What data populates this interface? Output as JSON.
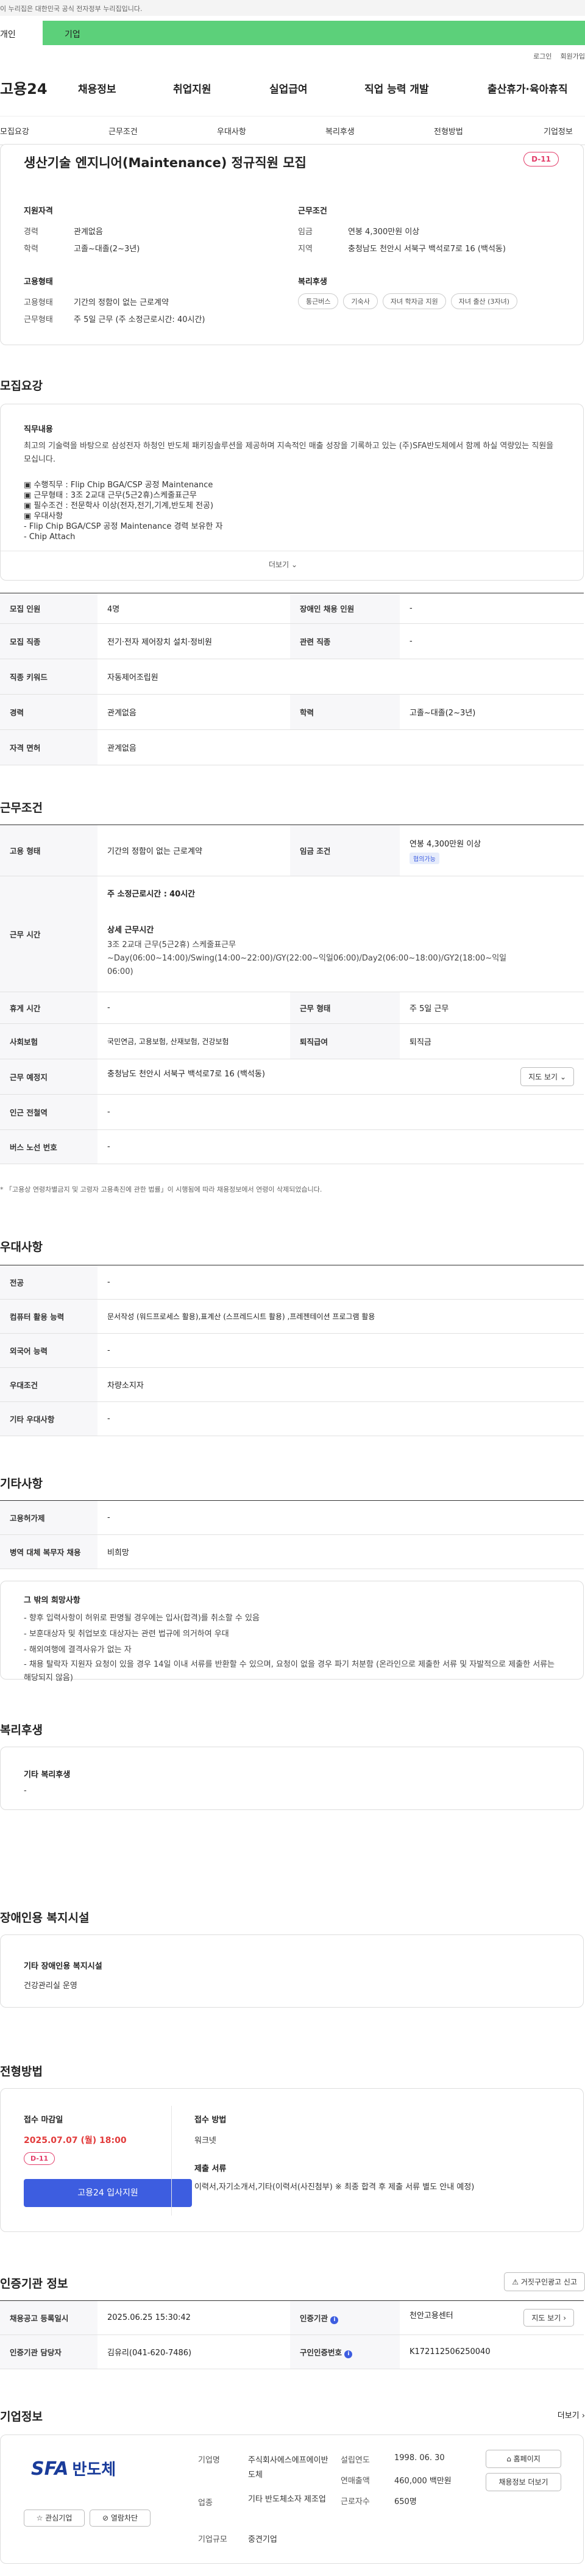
{
  "gov_banner": "이 누리집은 대한민국 공식 전자정부 누리집입니다.",
  "audience_tabs": [
    "개인",
    "기업"
  ],
  "util_links": [
    "로그인",
    "회원가입"
  ],
  "gnb": {
    "logo": "고용24",
    "menu": [
      "채용정보",
      "취업지원",
      "실업급여",
      "직업 능력 개발",
      "출산휴가·육아휴직"
    ]
  },
  "subnav": [
    "모집요강",
    "근무조건",
    "우대사항",
    "복리후생",
    "전형방법",
    "기업정보"
  ],
  "job": {
    "title": "생산기술 엔지니어(Maintenance) 정규직원 모집",
    "dday": "D-11",
    "qual_title": "지원자격",
    "qual": [
      {
        "k": "경력",
        "v": "관계없음"
      },
      {
        "k": "학력",
        "v": "고졸~대졸(2~3년)"
      }
    ],
    "cond_title": "근무조건",
    "cond": [
      {
        "k": "임금",
        "v": "연봉 4,300만원 이상"
      },
      {
        "k": "지역",
        "v": "충청남도 천안시 서북구 백석로7로 16 (백석동)"
      }
    ],
    "emp_title": "고용형태",
    "emp": [
      {
        "k": "고용형태",
        "v": "기간의 정함이 없는 근로계약"
      },
      {
        "k": "근무형태",
        "v": "주 5일 근무 (주 소정근로시간: 40시간)"
      }
    ],
    "welfare_title": "복리후생",
    "welfare_chips": [
      "통근버스",
      "기숙사",
      "자녀 학자금 지원",
      "자녀 출산 (3자녀)"
    ]
  },
  "recruit": {
    "title": "모집요강",
    "duty_title": "직무내용",
    "duty_intro": "최고의 기술력을 바탕으로 삼성전자 하청인 반도체 패키징솔루션을 제공하며 지속적인 매출 성장을 기록하고 있는 (주)SFA반도체에서 함께 하실 역량있는 직원을 모십니다.",
    "duty_lines": [
      "▣ 수행직무 : Flip Chip BGA/CSP 공정 Maintenance",
      "▣ 근무형태 : 3조 2교대 근무(5근2휴)스케줄표근무",
      "▣ 필수조건 : 전문학사 이상(전자,전기,기계,반도체 전공)",
      "▣ 우대사항",
      "- Flip Chip BGA/CSP 공정 Maintenance 경력 보유한 자",
      "- Chip Attach"
    ],
    "more": "더보기",
    "rows": [
      [
        {
          "th": "모집 인원",
          "td": "4명"
        },
        {
          "th": "장애인 채용 인원",
          "td": "-"
        }
      ],
      [
        {
          "th": "모집 직종",
          "td": "전기·전자 제어장치 설치·정비원"
        },
        {
          "th": "관련 직종",
          "td": "-"
        }
      ],
      [
        {
          "th": "직종 키워드",
          "td": "자동제어조립원"
        }
      ],
      [
        {
          "th": "경력",
          "td": "관계없음"
        },
        {
          "th": "학력",
          "td": "고졸~대졸(2~3년)"
        }
      ],
      [
        {
          "th": "자격 면허",
          "td": "관계없음"
        }
      ]
    ]
  },
  "work": {
    "title": "근무조건",
    "emp_th": "고용 형태",
    "emp_td": "기간의 정함이 없는 근로계약",
    "wage_th": "임금 조건",
    "wage_td": "연봉 4,300만원 이상",
    "wage_badge": "협의가능",
    "hours_th": "근무 시간",
    "hours_week": "주 소정근로시간 :",
    "hours_week_v": "40시간",
    "hours_detail_title": "상세 근무시간",
    "hours_detail": "3조 2교대 근무(5근2휴) 스케줄표근무\n~Day(06:00~14:00)/Swing(14:00~22:00)/GY(22:00~익일06:00)/Day2(06:00~18:00)/GY2(18:00~익일06:00)",
    "rows": [
      [
        {
          "th": "휴게 시간",
          "td": "-"
        },
        {
          "th": "근무 형태",
          "td": "주 5일 근무"
        }
      ],
      [
        {
          "th": "사회보험",
          "td": "국민연금, 고용보험, 산재보험, 건강보험"
        },
        {
          "th": "퇴직급여",
          "td": "퇴직금"
        }
      ]
    ],
    "place_th": "근무 예정지",
    "place_td": "충청남도 천안시 서북구 백석로7로 16 (백석동)",
    "map_btn": "지도 보기",
    "rows2": [
      {
        "th": "인근 전철역",
        "td": "-"
      },
      {
        "th": "버스 노선 번호",
        "td": "-"
      }
    ],
    "note": "* 「고용상 연령차별금지 및 고령자 고용촉진에 관한 법률」이 시행됨에 따라 채용정보에서 연령이 삭제되었습니다."
  },
  "pref": {
    "title": "우대사항",
    "rows": [
      {
        "th": "전공",
        "td": "-"
      },
      {
        "th": "컴퓨터 활용 능력",
        "td": "문서작성 (워드프로세스 활용),표계산 (스프레드시트 활용) ,프레젠테이션 프로그램 활용"
      },
      {
        "th": "외국어 능력",
        "td": "-"
      },
      {
        "th": "우대조건",
        "td": "차량소지자"
      },
      {
        "th": "기타 우대사항",
        "td": "-"
      }
    ]
  },
  "etc": {
    "title": "기타사항",
    "rows": [
      {
        "th": "고용허가제",
        "td": "-"
      },
      {
        "th": "병역 대체 복무자 채용",
        "td": "비희망"
      }
    ],
    "extra_title": "그 밖의 희망사항",
    "extra": [
      "- 향후 입력사항이 허위로 판명될 경우에는 입사(합격)를 취소할 수 있음",
      "- 보훈대상자 및 취업보호 대상자는 관련 법규에 의거하여 우대",
      "- 해외여행에 결격사유가 없는 자",
      "- 채용 탈락자 지원자 요청이 있을 경우 14일 이내 서류를 반환할 수 있으며, 요청이 없을 경우 파기 처분함 (온라인으로 제출한 서류 및 자발적으로 제출한 서류는 해당되지 않음)"
    ]
  },
  "welfare": {
    "title": "복리후생",
    "box_title": "기타 복리후생",
    "box_value": "-"
  },
  "disab": {
    "title": "장애인용 복지시설",
    "box_title": "기타 장애인용 복지시설",
    "box_value": "건강관리실 운영"
  },
  "process": {
    "title": "전형방법",
    "deadline_label": "접수 마감일",
    "deadline": "2025.07.07 (월) 18:00",
    "dday": "D-11",
    "apply_btn": "고용24 입사지원",
    "method_label": "접수 방법",
    "method": "워크넷",
    "docs_label": "제출 서류",
    "docs": "이력서,자기소개서,기타(이력서(사진첨부) ※ 최종 합격 후 제출 서류 별도 안내 예정)"
  },
  "certify": {
    "title": "인증기관 정보",
    "report_btn": "거짓구인광고 신고",
    "rows": [
      [
        {
          "th": "채용공고 등록일시",
          "td": "2025.06.25 15:30:42"
        },
        {
          "th": "인증기관",
          "td": "천안고용센터"
        }
      ],
      [
        {
          "th": "인증기관 담당자",
          "td": "김유리(041-620-7486)"
        },
        {
          "th": "구인인증번호",
          "td": "K172112506250040"
        }
      ]
    ],
    "map_btn": "지도 보기"
  },
  "company": {
    "title": "기업정보",
    "more": "더보기",
    "logo_a": "SFA",
    "logo_b": "반도체",
    "fav_btn": "관심기업",
    "block_btn": "열람차단",
    "k_name": "기업명",
    "v_name": "주식회사에스에프에이반도체",
    "k_industry": "업종",
    "v_industry": "기타 반도체소자 제조업",
    "k_size": "기업규모",
    "v_size": "중견기업",
    "k_est": "설립연도",
    "v_est": "1998. 06. 30",
    "k_sales": "연매출액",
    "v_sales": "460,000 백만원",
    "k_emp": "근로자수",
    "v_emp": "650명",
    "home_btn": "홈페이지",
    "jobs_btn": "채용정보 더보기"
  },
  "colors": {
    "accent": "#3d5de0",
    "brand_green": "#5cd07a",
    "dday": "#e33d6a",
    "deadline": "#e23b3b"
  }
}
